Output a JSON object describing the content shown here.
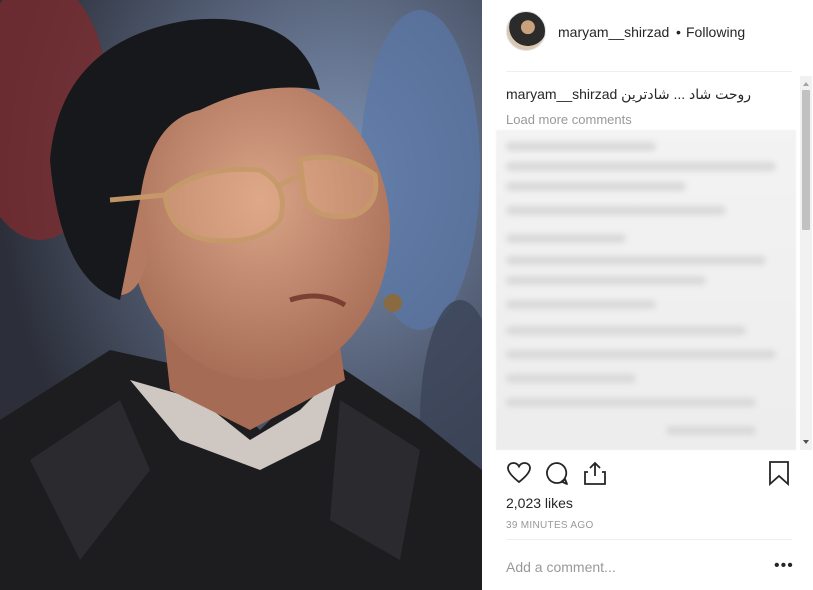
{
  "post": {
    "image_alt": "Portrait of a man wearing tinted glasses and a black leather jacket"
  },
  "header": {
    "username": "maryam__shirzad",
    "separator": "•",
    "follow_status": "Following"
  },
  "caption": {
    "username": "maryam__shirzad",
    "text": "روحت شاد ... شادترین"
  },
  "comments": {
    "load_more_label": "Load more comments"
  },
  "actions": {
    "like_icon": "heart-icon",
    "comment_icon": "comment-icon",
    "share_icon": "share-icon",
    "save_icon": "bookmark-icon"
  },
  "stats": {
    "likes": "2,023 likes",
    "timestamp": "39 MINUTES AGO"
  },
  "comment_box": {
    "placeholder": "Add a comment...",
    "more_label": "•••"
  }
}
